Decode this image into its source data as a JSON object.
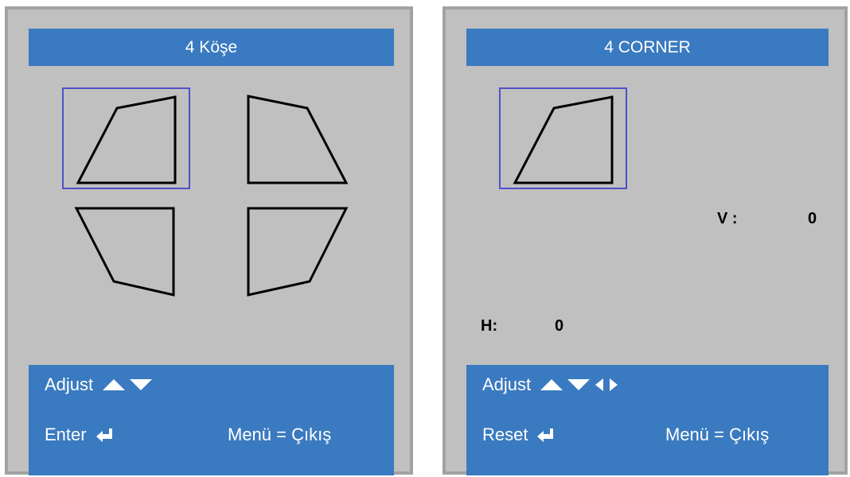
{
  "left_panel": {
    "title": "4 Köşe",
    "footer": {
      "adjust_label": "Adjust",
      "enter_label": "Enter",
      "menu_exit": "Menü = Çıkış"
    }
  },
  "right_panel": {
    "title": "4 CORNER",
    "v_label": "V :",
    "v_value": "0",
    "h_label": "H:",
    "h_value": "0",
    "footer": {
      "adjust_label": "Adjust",
      "reset_label": "Reset",
      "menu_exit": "Menü = Çıkış"
    }
  },
  "colors": {
    "bar_blue": "#3a7ac0",
    "panel_gray": "#c0c0c0",
    "selection_border": "#5050c8"
  },
  "icons": [
    "up-arrow-icon",
    "down-arrow-icon",
    "left-arrow-icon",
    "right-arrow-icon",
    "enter-return-icon"
  ]
}
